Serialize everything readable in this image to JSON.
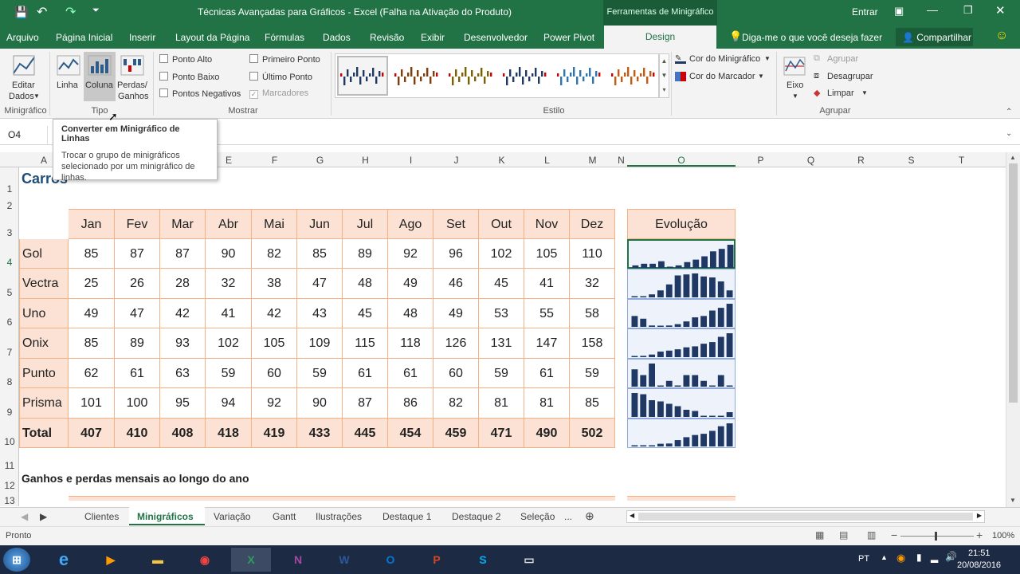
{
  "window": {
    "title": "Técnicas Avançadas para Gráficos - Excel (Falha na Ativação do Produto)",
    "context_tab": "Ferramentas de Minigráfico",
    "signin": "Entrar"
  },
  "tabs": [
    "Arquivo",
    "Página Inicial",
    "Inserir",
    "Layout da Página",
    "Fórmulas",
    "Dados",
    "Revisão",
    "Exibir",
    "Desenvolvedor",
    "Power Pivot",
    "Design"
  ],
  "tell_me": "Diga-me o que você deseja fazer",
  "share": "Compartilhar",
  "ribbon": {
    "edit_data": "Editar",
    "edit_data2": "Dados",
    "group_sparkline": "Minigráfico",
    "type_line": "Linha",
    "type_column": "Coluna",
    "type_winloss": "Perdas/",
    "type_winloss2": "Ganhos",
    "group_type": "Tipo",
    "show": {
      "high": "Ponto Alto",
      "low": "Ponto Baixo",
      "negative": "Pontos Negativos",
      "first": "Primeiro Ponto",
      "last": "Último Ponto",
      "markers": "Marcadores"
    },
    "group_show": "Mostrar",
    "group_style": "Estilo",
    "sparkline_color": "Cor do Minigráfico",
    "marker_color": "Cor do Marcador",
    "axis": "Eixo",
    "group_btn": "Agrupar",
    "ungroup": "Desagrupar",
    "clear": "Limpar",
    "group_group": "Agrupar",
    "style_colors": [
      "#1f3864",
      "#843c0c",
      "#7f6000",
      "#1f3864",
      "#2e75b6",
      "#c55a11"
    ]
  },
  "tooltip": {
    "title": "Converter em Minigráfico de Linhas",
    "body": "Trocar o grupo de minigráficos selecionado por um minigráfico de linhas."
  },
  "namebox": "O4",
  "columns": [
    "A",
    "B",
    "C",
    "D",
    "E",
    "F",
    "G",
    "H",
    "I",
    "J",
    "K",
    "L",
    "M",
    "N",
    "O",
    "P",
    "Q",
    "R",
    "S",
    "T"
  ],
  "rows": [
    "1",
    "2",
    "3",
    "4",
    "5",
    "6",
    "7",
    "8",
    "9",
    "10",
    "11",
    "12",
    "13"
  ],
  "sheet": {
    "title": "Carros",
    "months": [
      "Jan",
      "Fev",
      "Mar",
      "Abr",
      "Mai",
      "Jun",
      "Jul",
      "Ago",
      "Set",
      "Out",
      "Nov",
      "Dez"
    ],
    "evolution_header": "Evolução",
    "table": [
      {
        "name": "Gol",
        "values": [
          85,
          87,
          87,
          90,
          82,
          85,
          89,
          92,
          96,
          102,
          105,
          110
        ]
      },
      {
        "name": "Vectra",
        "values": [
          25,
          26,
          28,
          32,
          38,
          47,
          48,
          49,
          46,
          45,
          41,
          32
        ]
      },
      {
        "name": "Uno",
        "values": [
          49,
          47,
          42,
          41,
          42,
          43,
          45,
          48,
          49,
          53,
          55,
          58
        ]
      },
      {
        "name": "Onix",
        "values": [
          85,
          89,
          93,
          102,
          105,
          109,
          115,
          118,
          126,
          131,
          147,
          158
        ]
      },
      {
        "name": "Punto",
        "values": [
          62,
          61,
          63,
          59,
          60,
          59,
          61,
          61,
          60,
          59,
          61,
          59
        ]
      },
      {
        "name": "Prisma",
        "values": [
          101,
          100,
          95,
          94,
          92,
          90,
          87,
          86,
          82,
          81,
          81,
          85
        ]
      }
    ],
    "total": {
      "name": "Total",
      "values": [
        407,
        410,
        408,
        418,
        419,
        433,
        445,
        454,
        459,
        471,
        490,
        502
      ]
    },
    "subtitle": "Ganhos e perdas mensais ao longo do ano"
  },
  "sheet_tabs": [
    "Clientes",
    "Minigráficos",
    "Variação",
    "Gantt",
    "Ilustrações",
    "Destaque 1",
    "Destaque 2",
    "Seleção",
    "..."
  ],
  "active_sheet": "Minigráficos",
  "status": {
    "ready": "Pronto",
    "zoom": "100%"
  },
  "taskbar": {
    "lang": "PT",
    "time": "21:51",
    "date": "20/08/2016"
  },
  "sparkline_color": "#1f3864"
}
